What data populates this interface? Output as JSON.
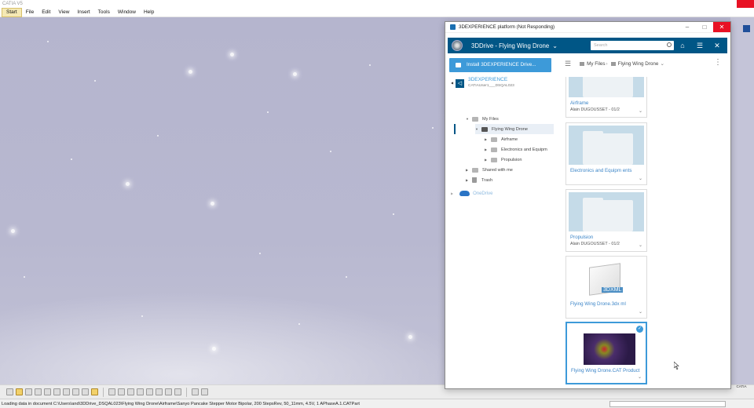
{
  "catia": {
    "title": "CATIA V5",
    "menu": [
      "Start",
      "File",
      "Edit",
      "View",
      "Insert",
      "Tools",
      "Window",
      "Help"
    ],
    "status": "Loading data in document C:\\Users\\and\\3DDrive_DSQAL023\\Flying Wing Drone\\Airframe\\Sanyo Pancake Stepper Motor Bipolar, 200 StepsRev, 50_11mm, 4.5V, 1 APhaseA.1.CATPart",
    "logo": "CATIA"
  },
  "window": {
    "title": "3DEXPERIENCE platform (Not Responding)",
    "app_title": "3DDrive - Flying Wing Drone",
    "search_placeholder": "Search",
    "install_label": "Install 3DEXPERIENCE Drive...",
    "tree": {
      "root_name": "3DEXPERIENCE",
      "root_sub": "CATIAUser1___DSQAL023",
      "my_files": "My Files",
      "project": "Flying Wing Drone",
      "children": [
        "Airframe",
        "Electronics and Equipm",
        "Propulsion"
      ],
      "shared": "Shared with me",
      "trash": "Trash",
      "onedrive": "OneDrive"
    },
    "breadcrumb": [
      "My Files",
      "Flying Wing Drone"
    ],
    "cards": [
      {
        "name": "Airframe",
        "owner": "Alain DUGOUSSET  - 01/2",
        "kind": "folder"
      },
      {
        "name": "Electronics and Equipm ents",
        "owner": "",
        "kind": "folder"
      },
      {
        "name": "Propulsion",
        "owner": "Alain DUGOUSSET  - 01/2",
        "kind": "folder"
      },
      {
        "name": "Flying Wing Drone.3dx ml",
        "owner": "",
        "kind": "3dxml",
        "badge": "3DXML"
      },
      {
        "name": "Flying Wing Drone.CAT Product",
        "owner": "",
        "kind": "catproduct",
        "selected": true
      }
    ]
  },
  "colors": {
    "brand": "#005686",
    "accent": "#3d9ad9"
  }
}
